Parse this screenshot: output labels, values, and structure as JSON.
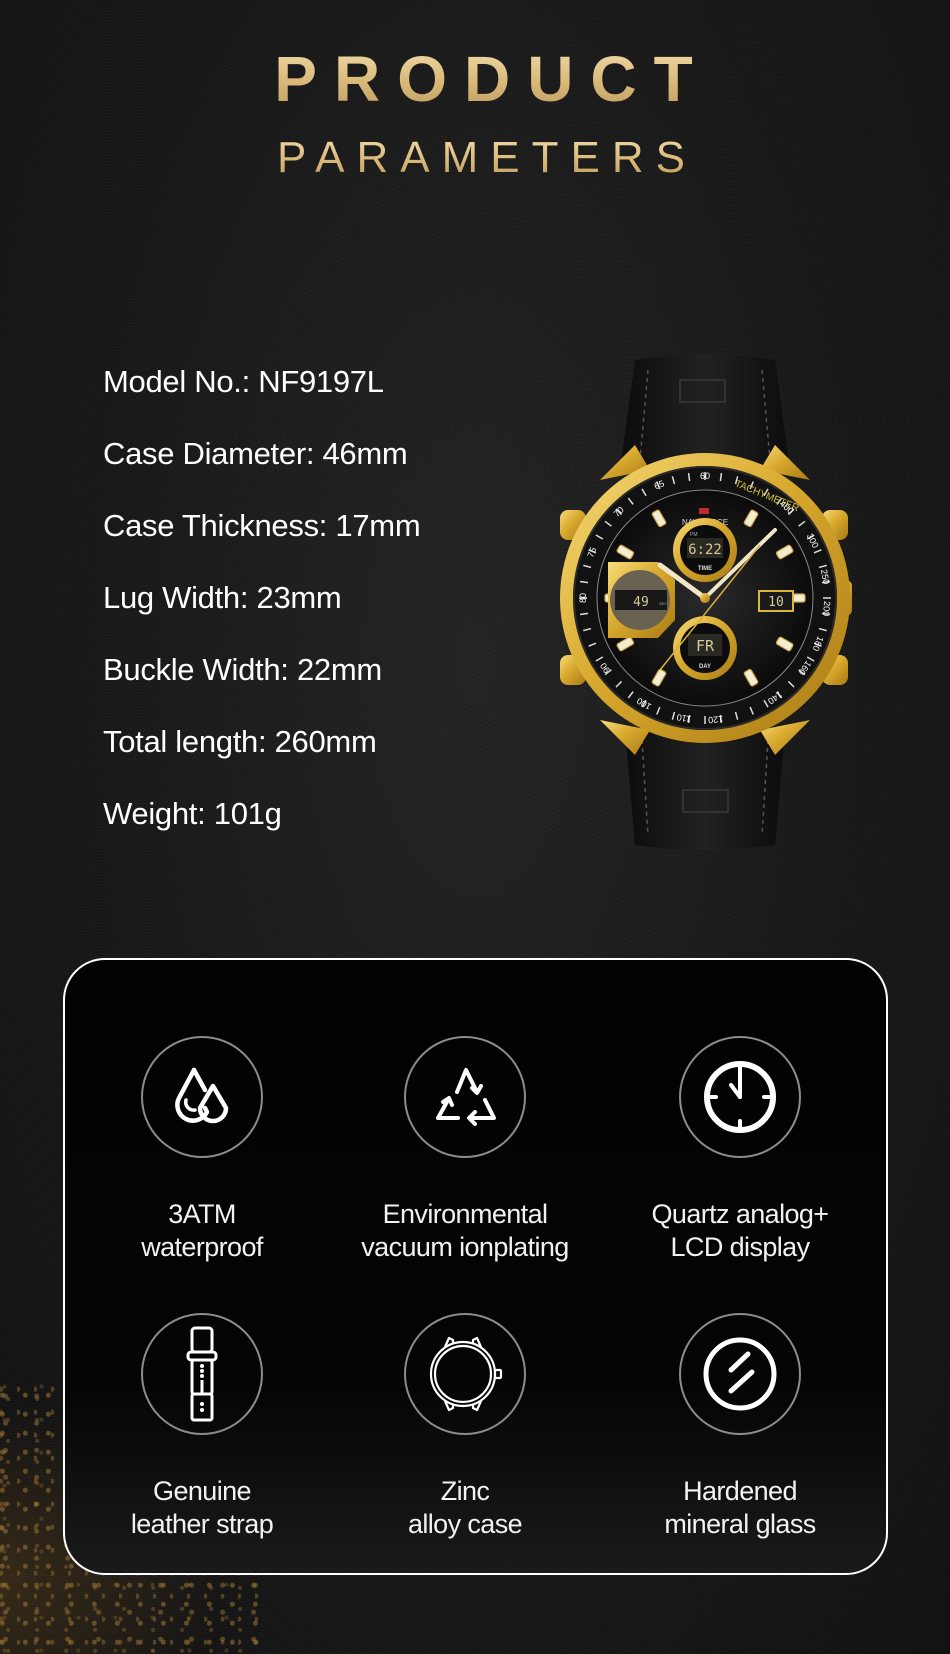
{
  "header": {
    "title_line1": "PRODUCT",
    "title_line2": "PARAMETERS"
  },
  "specs": [
    {
      "label": "Model No.:",
      "value": "NF9197L"
    },
    {
      "label": "Case Diameter:",
      "value": "46mm"
    },
    {
      "label": "Case Thickness:",
      "value": "17mm"
    },
    {
      "label": "Lug Width:",
      "value": "23mm"
    },
    {
      "label": "Buckle Width:",
      "value": "22mm"
    },
    {
      "label": "Total length:",
      "value": "260mm"
    },
    {
      "label": "Weight:",
      "value": "101g"
    }
  ],
  "watch": {
    "brand": "NAVIFORCE",
    "bezel_text": "TACHYMETER",
    "time_display": "6:22",
    "time_period": "PM",
    "time_label": "TIME",
    "seconds_display": "49",
    "seconds_label": "SEC",
    "date_display": "10",
    "day_display": "FR",
    "day_label": "DAY",
    "bezel_numbers": [
      "60",
      "65",
      "70",
      "75",
      "80",
      "90",
      "100",
      "110",
      "120",
      "140",
      "160",
      "180",
      "200",
      "250",
      "300",
      "400"
    ]
  },
  "features": [
    {
      "icon": "water-drops-icon",
      "line1": "3ATM",
      "line2": "waterproof"
    },
    {
      "icon": "recycle-icon",
      "line1": "Environmental",
      "line2": "vacuum ionplating"
    },
    {
      "icon": "clock-icon",
      "line1": "Quartz analog+",
      "line2": "LCD display"
    },
    {
      "icon": "leather-strap-icon",
      "line1": "Genuine",
      "line2": "leather strap"
    },
    {
      "icon": "watch-case-icon",
      "line1": "Zinc",
      "line2": "alloy case"
    },
    {
      "icon": "mineral-glass-icon",
      "line1": "Hardened",
      "line2": "mineral glass"
    }
  ],
  "colors": {
    "gold": "#d9b878",
    "background": "#1a1a1a",
    "panel": "#030303",
    "text": "#ffffff"
  }
}
